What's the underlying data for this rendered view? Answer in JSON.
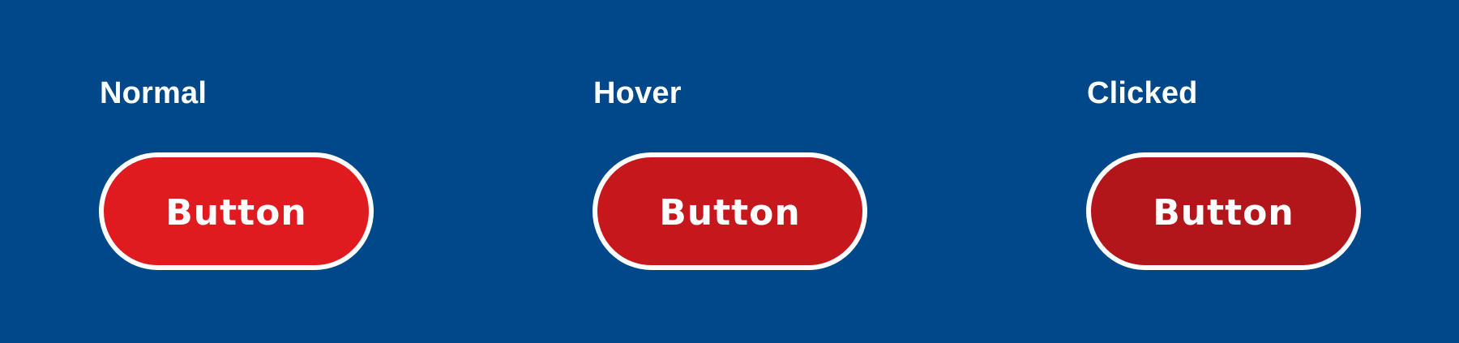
{
  "states": [
    {
      "title": "Normal",
      "button_label": "Button",
      "fill_color": "#df1b20"
    },
    {
      "title": "Hover",
      "button_label": "Button",
      "fill_color": "#c5171c"
    },
    {
      "title": "Clicked",
      "button_label": "Button",
      "fill_color": "#b3161a"
    }
  ],
  "colors": {
    "background": "#004889",
    "text": "#ffffff",
    "button_border": "#ffffff"
  }
}
